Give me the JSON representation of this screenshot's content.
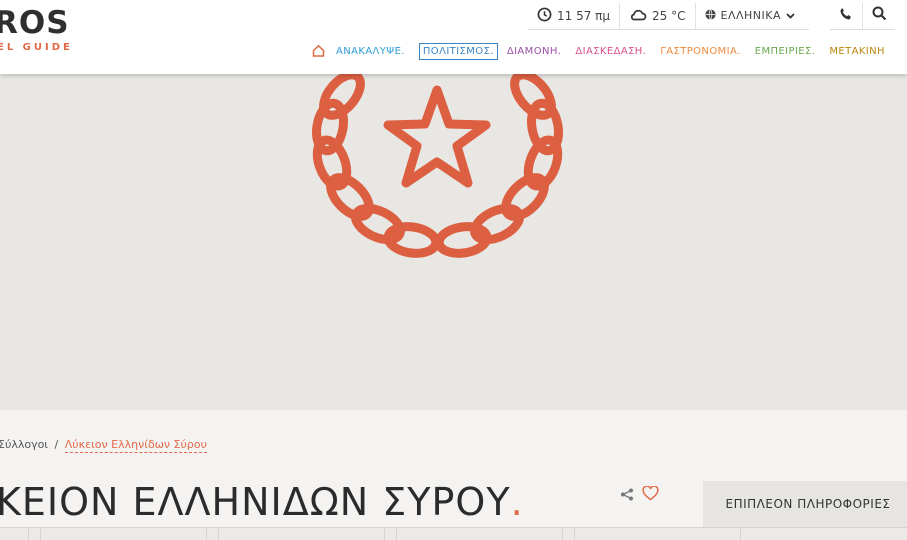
{
  "header": {
    "logo_main": "ROS",
    "logo_sub": "EL GUIDE",
    "time": "11 57 πμ",
    "weather": "25 °C",
    "language": "ΕΛΛΗΝΙΚΑ"
  },
  "nav": {
    "items": [
      {
        "label": "ΑΝΑΚΑΛΥΨΕ.",
        "color": "#2f9ed8"
      },
      {
        "label": "ΠΟΛΙΤΙΣΜΟΣ.",
        "color": "#3a84c4"
      },
      {
        "label": "ΔΙΑΜΟΝΗ.",
        "color": "#9b4ea8"
      },
      {
        "label": "ΔΙΑΣΚΕΔΑΣΗ.",
        "color": "#d9508d"
      },
      {
        "label": "ΓΑΣΤΡΟΝΟΜΙΑ.",
        "color": "#f08a3c"
      },
      {
        "label": "ΕΜΠΕΙΡΙΕΣ.",
        "color": "#6aa84f"
      },
      {
        "label": "ΜΕΤΑΚΙΝΗ",
        "color": "#b8860b"
      }
    ]
  },
  "breadcrumb": {
    "parent": "Σύλλογοι",
    "separator": "/",
    "current": "Λύκειον Ελληνίδων Σύρου"
  },
  "page": {
    "title": "ΚΕΙΟΝ ΕΛΛΗΝΙΔΩΝ ΣΥΡΟΥ",
    "title_dot": ".",
    "more_info": "ΕΠΙΠΛΕΟΝ ΠΛΗΡΟΦΟΡΙΕΣ"
  },
  "colors": {
    "accent": "#e06a47",
    "emblem": "#dc5f42"
  }
}
